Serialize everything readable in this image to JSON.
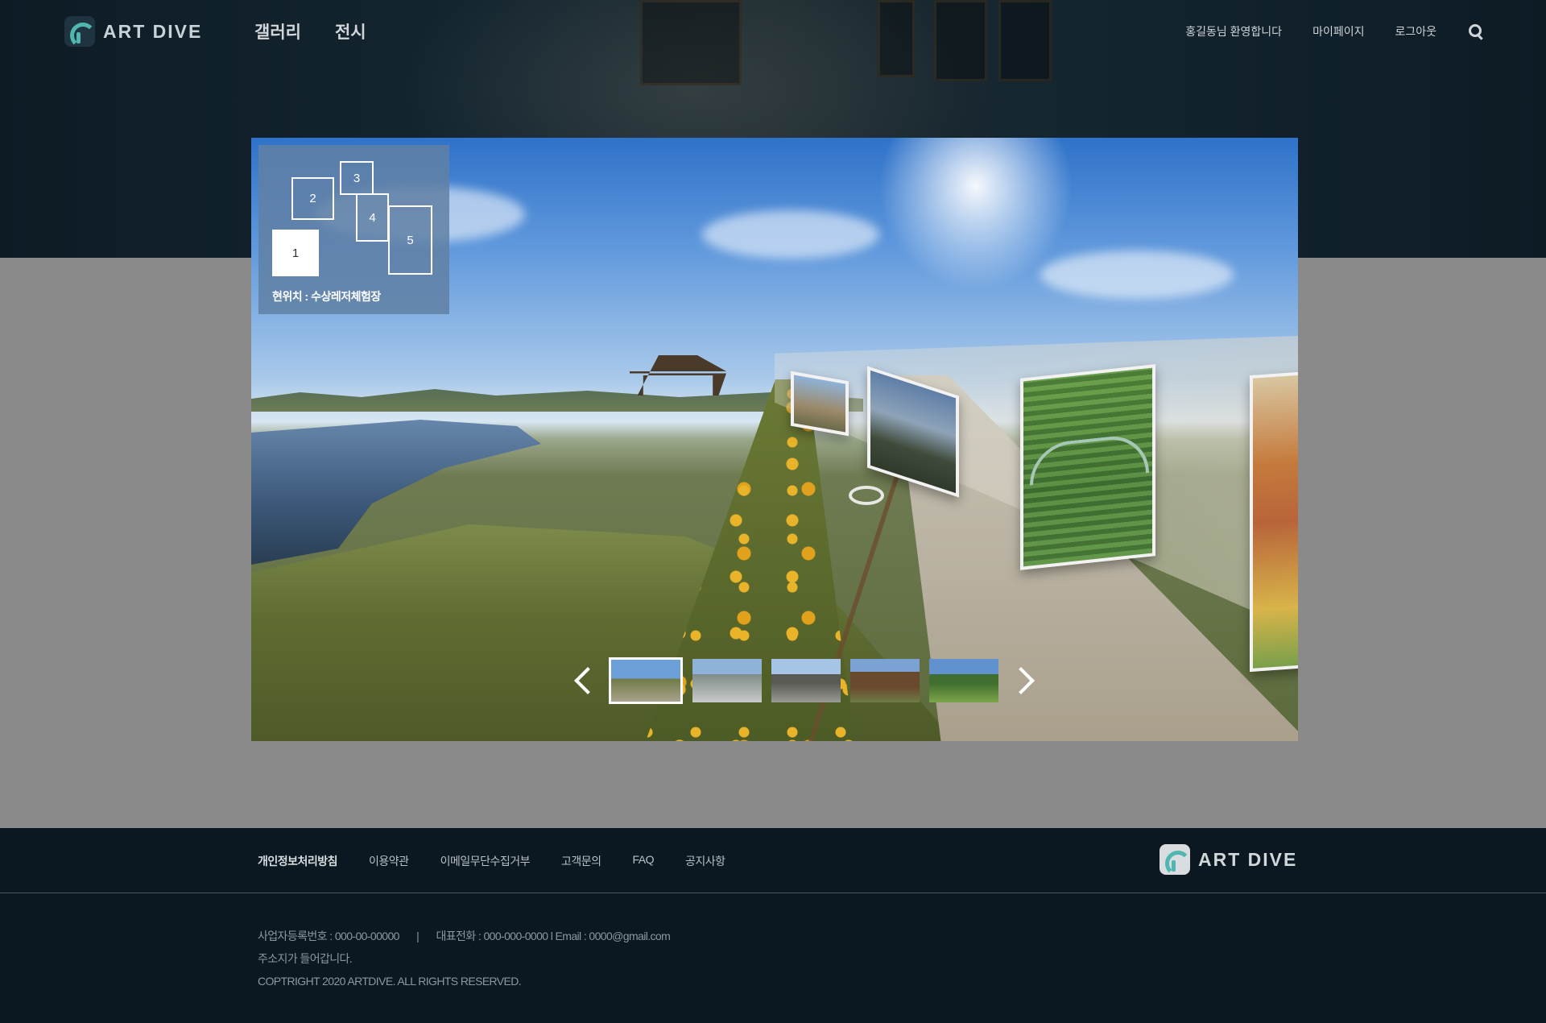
{
  "brand": {
    "name": "ART DIVE"
  },
  "header": {
    "nav": [
      "갤러리",
      "전시"
    ],
    "user_greeting": "홍길동님 환영합니다",
    "mypage": "마이페이지",
    "logout": "로그아웃",
    "search_icon": "search-icon"
  },
  "viewer": {
    "minimap": {
      "rooms": [
        "1",
        "2",
        "3",
        "4",
        "5"
      ],
      "active_room": "1",
      "location": "현위치 : 수상레저체험장"
    },
    "thumbnails": {
      "count": 5,
      "selected_index": 0,
      "prev_icon": "chevron-left-icon",
      "next_icon": "chevron-right-icon"
    }
  },
  "footer": {
    "links": [
      "개인정보처리방침",
      "이용약관",
      "이메일무단수집거부",
      "고객문의",
      "FAQ",
      "공지사항"
    ],
    "business_no": "사업자등록번호 : 000-00-00000",
    "divider": "|",
    "phone": "대표전화 : 000-000-0000",
    "email": "l Email : 0000@gmail.com",
    "address": "주소지가 들어갑니다.",
    "copyright": "COPTRIGHT 2020 ARTDIVE. ALL RIGHTS RESERVED."
  }
}
